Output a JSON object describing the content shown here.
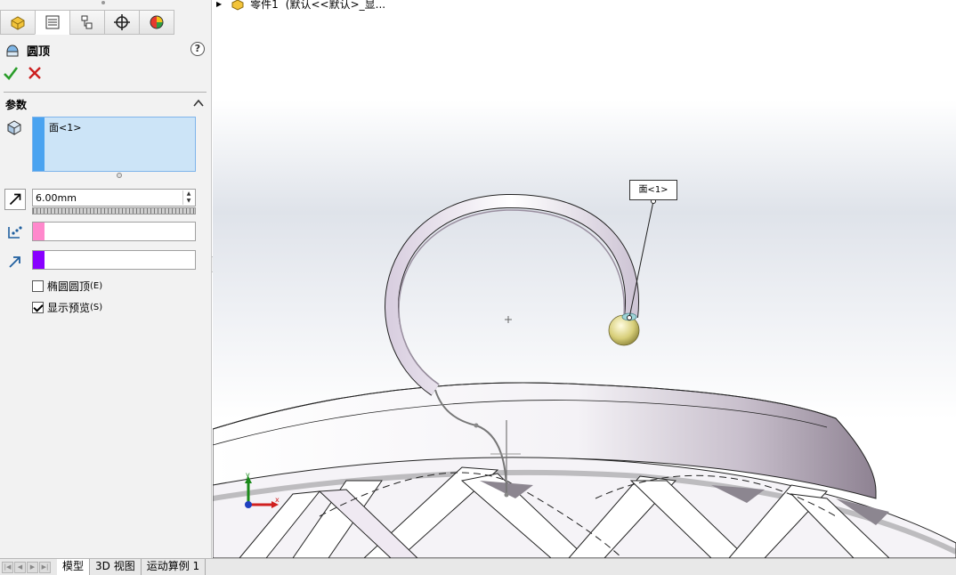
{
  "tree": {
    "part_name": "零件1",
    "config": "(默认<<默认>_显..."
  },
  "feature": {
    "title": "圆顶",
    "help": "?"
  },
  "group": {
    "title": "参数"
  },
  "faces": {
    "items": [
      "面<1>"
    ]
  },
  "distance": {
    "value": "6.00mm"
  },
  "colors": {
    "accent": "#4aa3f0",
    "ref_swatch": "#ff88cc",
    "dir_swatch": "#8800ff",
    "ok": "#2a9d2a",
    "cancel": "#cc1f1f"
  },
  "options": [
    {
      "label": "椭圆圆顶",
      "hotkey": "(E)",
      "checked": false
    },
    {
      "label": "显示预览",
      "hotkey": "(S)",
      "checked": true
    }
  ],
  "callout": {
    "label": "面<1>"
  },
  "axes": {
    "x": "x",
    "y": "y"
  },
  "bottom_tabs": [
    "模型",
    "3D 视图",
    "运动算例 1"
  ]
}
